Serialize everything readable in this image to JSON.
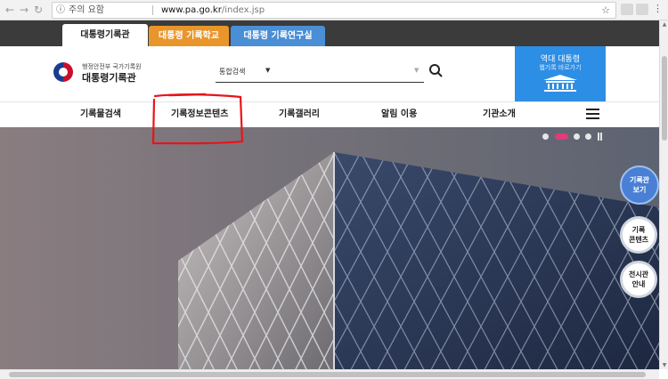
{
  "browser": {
    "security_label": "주의 요함",
    "url_host": "www.pa.go.kr",
    "url_path": "/index.jsp"
  },
  "top_tabs": [
    {
      "label": "대통령기록관"
    },
    {
      "label": "대통령 기록학교"
    },
    {
      "label": "대통령 기록연구실"
    }
  ],
  "header": {
    "logo_sub": "행정안전부 국가기록원",
    "logo_main": "대통령기록관",
    "search_scope": "통합검색"
  },
  "promo": {
    "line1": "역대 대통령",
    "line2": "웹기록 바로가기"
  },
  "main_nav": [
    {
      "label": "기록물검색"
    },
    {
      "label": "기록정보콘텐츠"
    },
    {
      "label": "기록갤러리"
    },
    {
      "label": "알림 이용"
    },
    {
      "label": "기관소개"
    }
  ],
  "slider": {
    "slide_count": 4,
    "active_index": 1
  },
  "quick_buttons": [
    {
      "label": "기록관\n보기"
    },
    {
      "label": "기록\n콘텐츠"
    },
    {
      "label": "전시관\n안내"
    }
  ],
  "colors": {
    "tab_orange": "#e8962b",
    "tab_blue": "#4a8ed6",
    "promo_blue": "#2d8ee5",
    "annotation_red": "#e8141b",
    "slider_active": "#e23b7a"
  }
}
